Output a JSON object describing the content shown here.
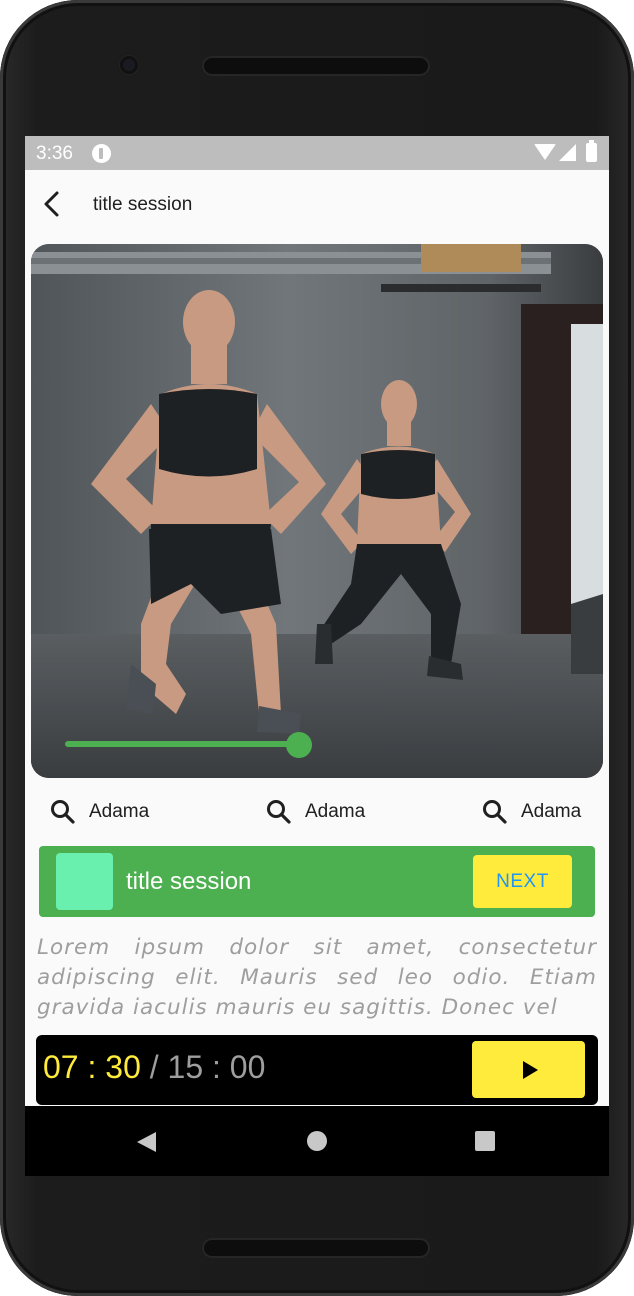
{
  "status_bar": {
    "time": "3:36",
    "icons": [
      "app-notification-icon",
      "wifi-icon",
      "signal-icon",
      "battery-icon"
    ]
  },
  "app_bar": {
    "back_icon": "arrow-back-icon",
    "title": "title session"
  },
  "hero": {
    "image": "workout-photo-two-women-doing-lunges",
    "progress": 0.44,
    "progress_color": "#4caf50"
  },
  "info_items": [
    {
      "icon": "search-icon",
      "label": "Adama"
    },
    {
      "icon": "search-icon",
      "label": "Adama"
    },
    {
      "icon": "search-icon",
      "label": "Adama"
    }
  ],
  "banner": {
    "title": "title session",
    "next_label": "NEXT",
    "background_color": "#4caf50",
    "thumb_color": "#69f0ae",
    "button_color": "#ffeb3b",
    "button_text_color": "#2196f3"
  },
  "description": "Lorem ipsum dolor sit amet, consectetur adipiscing elit. Mauris sed leo odio. Etiam gravida iaculis mauris eu sagittis. Donec vel",
  "timer": {
    "elapsed": "07 : 30",
    "separator": " / ",
    "total": "15 : 00",
    "play_icon": "play-icon",
    "elapsed_color": "#ffeb3b"
  },
  "nav_bar": {
    "icons": [
      "nav-back-icon",
      "nav-home-icon",
      "nav-recents-icon"
    ]
  }
}
